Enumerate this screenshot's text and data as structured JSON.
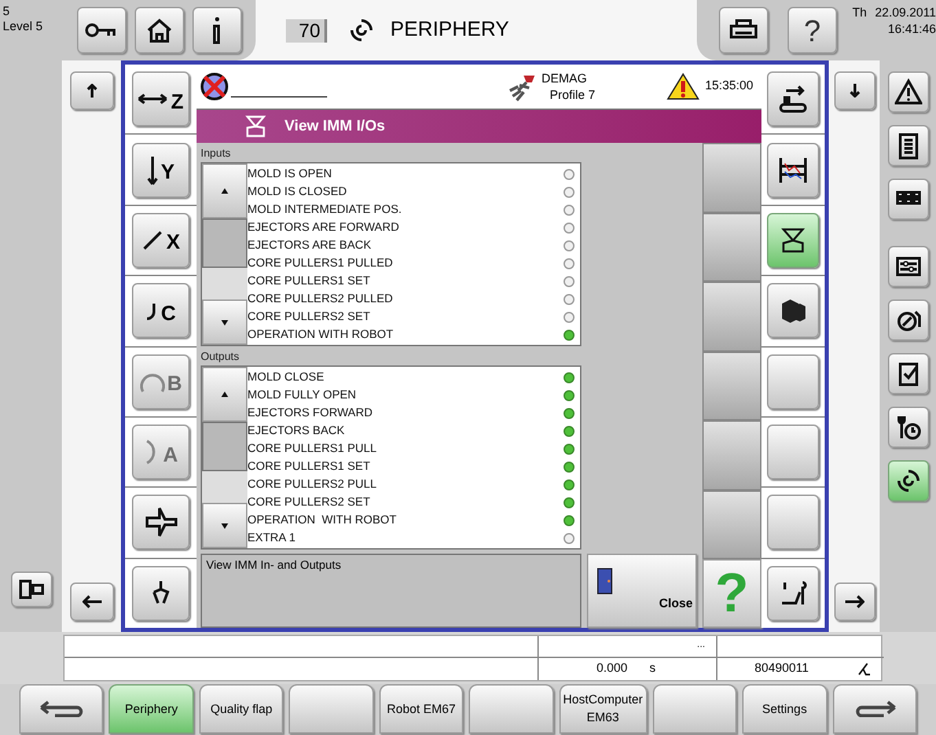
{
  "header": {
    "level_number": "5",
    "level": "Level 5",
    "counter": "70",
    "title": "PERIPHERY",
    "help_glyph": "?",
    "weekday": "Th",
    "date": "22.09.2011",
    "time": "16:41:46"
  },
  "left_tools": [
    {
      "label": "Z",
      "disabled": false
    },
    {
      "label": "Y",
      "disabled": false
    },
    {
      "label": "X",
      "disabled": false
    },
    {
      "label": "C",
      "disabled": false
    },
    {
      "label": "B",
      "disabled": true
    },
    {
      "label": "A",
      "disabled": true
    },
    {
      "disabled": false
    },
    {
      "disabled": false
    }
  ],
  "panel": {
    "machine": "DEMAG",
    "profile": "Profile 7",
    "clock": "15:35:00",
    "title": "View IMM I/Os",
    "inputs": {
      "heading": "Inputs",
      "signals": [
        {
          "label": "MOLD IS OPEN",
          "on": false
        },
        {
          "label": "MOLD IS CLOSED",
          "on": false
        },
        {
          "label": "MOLD INTERMEDIATE POS.",
          "on": false
        },
        {
          "label": "EJECTORS ARE FORWARD",
          "on": false
        },
        {
          "label": "EJECTORS ARE BACK",
          "on": false
        },
        {
          "label": "CORE PULLERS1 PULLED",
          "on": false
        },
        {
          "label": "CORE PULLERS1 SET",
          "on": false
        },
        {
          "label": "CORE PULLERS2 PULLED",
          "on": false
        },
        {
          "label": "CORE PULLERS2 SET",
          "on": false
        },
        {
          "label": "OPERATION WITH ROBOT",
          "on": true
        }
      ]
    },
    "outputs": {
      "heading": "Outputs",
      "signals": [
        {
          "label": "MOLD CLOSE",
          "on": true
        },
        {
          "label": "MOLD FULLY OPEN",
          "on": true
        },
        {
          "label": "EJECTORS FORWARD",
          "on": true
        },
        {
          "label": "EJECTORS BACK",
          "on": true
        },
        {
          "label": "CORE PULLERS1 PULL",
          "on": true
        },
        {
          "label": "CORE PULLERS1 SET",
          "on": true
        },
        {
          "label": "CORE PULLERS2 PULL",
          "on": true
        },
        {
          "label": "CORE PULLERS2 SET",
          "on": true
        },
        {
          "label": "OPERATION  WITH ROBOT",
          "on": true
        },
        {
          "label": "EXTRA 1",
          "on": false
        }
      ]
    },
    "description": "View IMM In- and Outputs",
    "close": "Close",
    "help": "?"
  },
  "right_tools": [
    {
      "selected": false
    },
    {
      "selected": false
    },
    {
      "selected": true
    },
    {
      "selected": false
    },
    {
      "selected": false
    },
    {
      "selected": false
    },
    {
      "selected": false
    },
    {
      "selected": false
    }
  ],
  "side_nav": [
    {
      "selected": false
    },
    {
      "selected": false
    },
    {
      "selected": false
    },
    {
      "selected": false
    },
    {
      "selected": false
    },
    {
      "selected": false
    },
    {
      "selected": false
    },
    {
      "selected": true
    }
  ],
  "status": {
    "ellipsis": "...",
    "duration": "0.000",
    "unit": "s",
    "counter": "80490011"
  },
  "footer": [
    {
      "kind": "back",
      "selected": false
    },
    {
      "kind": "text",
      "label": "Periphery",
      "selected": true
    },
    {
      "kind": "text",
      "label": "Quality flap",
      "selected": false
    },
    {
      "kind": "blank",
      "selected": false
    },
    {
      "kind": "text",
      "label": "Robot EM67",
      "selected": false
    },
    {
      "kind": "blank",
      "selected": false
    },
    {
      "kind": "text",
      "label": "HostComputer EM63",
      "selected": false
    },
    {
      "kind": "blank",
      "selected": false
    },
    {
      "kind": "text",
      "label": "Settings",
      "selected": false
    },
    {
      "kind": "forward",
      "selected": false
    }
  ]
}
